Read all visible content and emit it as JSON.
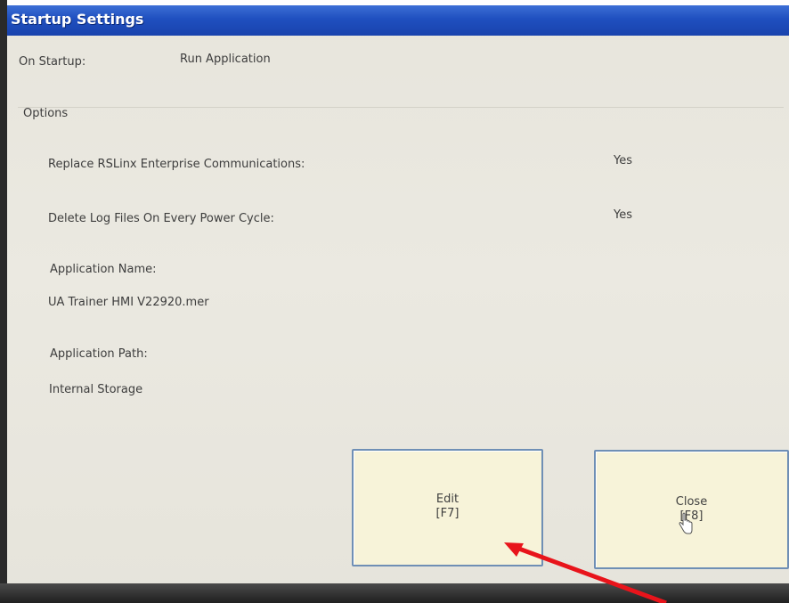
{
  "window": {
    "title": "Startup Settings"
  },
  "startup": {
    "label": "On Startup:",
    "value": "Run Application"
  },
  "options": {
    "heading": "Options",
    "replace_rslinx": {
      "label": "Replace RSLinx Enterprise Communications:",
      "value": "Yes"
    },
    "delete_logs": {
      "label": "Delete Log Files On Every Power Cycle:",
      "value": "Yes"
    },
    "application_name": {
      "label": "Application Name:",
      "value": "UA Trainer HMI V22920.mer"
    },
    "application_path": {
      "label": "Application Path:",
      "value": "Internal Storage"
    }
  },
  "buttons": {
    "edit": {
      "label": "Edit",
      "key": "[F7]"
    },
    "close": {
      "label": "Close",
      "key": "[F8]"
    }
  },
  "annotation": {
    "arrow_color": "#e8141b"
  },
  "colors": {
    "title_bar": "#1f4fbf",
    "button_face": "#f7f3d9",
    "button_border": "#6f8fb5",
    "background": "#e9e7df"
  }
}
